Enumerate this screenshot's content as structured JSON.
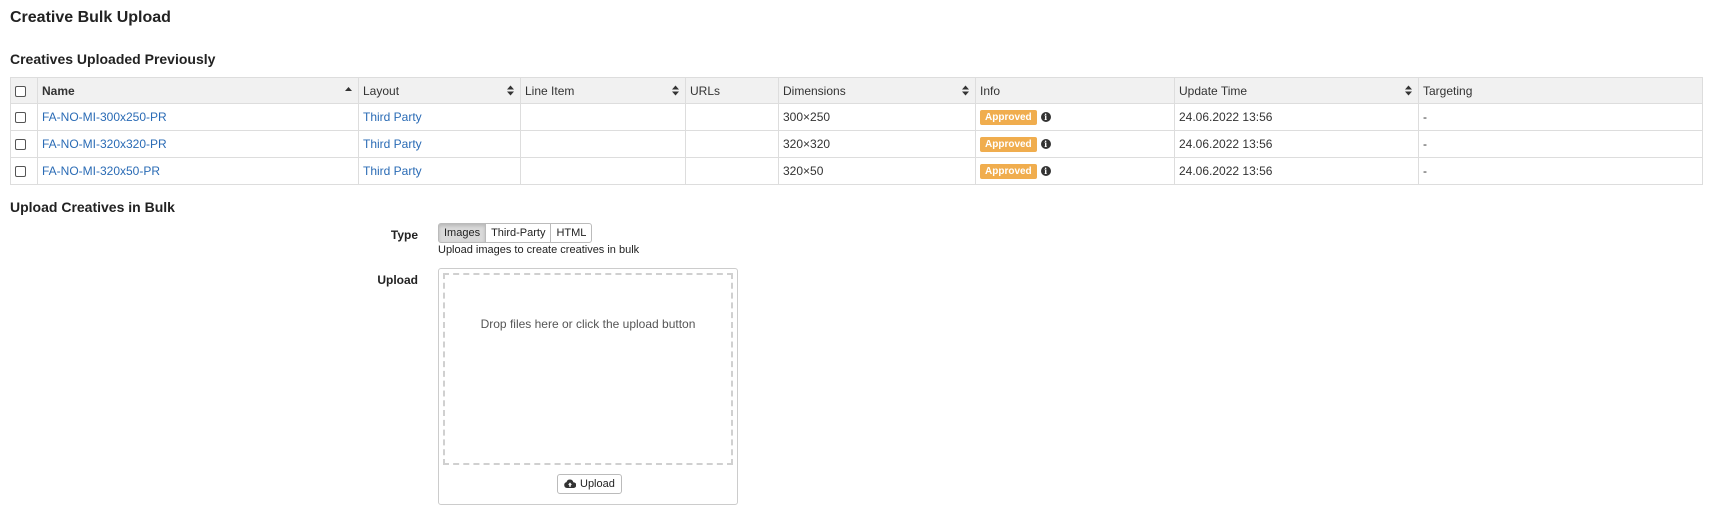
{
  "page_title": "Creative Bulk Upload",
  "previous_section": {
    "title": "Creatives Uploaded Previously",
    "columns": {
      "name": "Name",
      "layout": "Layout",
      "line_item": "Line Item",
      "urls": "URLs",
      "dimensions": "Dimensions",
      "info": "Info",
      "update_time": "Update Time",
      "targeting": "Targeting"
    },
    "rows": [
      {
        "name": "FA-NO-MI-300x250-PR",
        "layout": "Third Party",
        "line_item": "",
        "urls": "",
        "dimensions": "300×250",
        "status": "Approved",
        "update_time": "24.06.2022 13:56",
        "targeting": "-"
      },
      {
        "name": "FA-NO-MI-320x320-PR",
        "layout": "Third Party",
        "line_item": "",
        "urls": "",
        "dimensions": "320×320",
        "status": "Approved",
        "update_time": "24.06.2022 13:56",
        "targeting": "-"
      },
      {
        "name": "FA-NO-MI-320x50-PR",
        "layout": "Third Party",
        "line_item": "",
        "urls": "",
        "dimensions": "320×50",
        "status": "Approved",
        "update_time": "24.06.2022 13:56",
        "targeting": "-"
      }
    ]
  },
  "bulk_section": {
    "title": "Upload Creatives in Bulk",
    "type_label": "Type",
    "type_options": [
      "Images",
      "Third-Party",
      "HTML"
    ],
    "type_selected": "Images",
    "type_help": "Upload images to create creatives in bulk",
    "upload_label": "Upload",
    "drop_text": "Drop files here or click the upload button",
    "upload_button": "Upload",
    "upload_button_icon": "cloud-upload-icon"
  },
  "colors": {
    "link": "#2a6bb5",
    "badge_approved": "#f0ad4e",
    "header_bg": "#f1f1f1"
  }
}
